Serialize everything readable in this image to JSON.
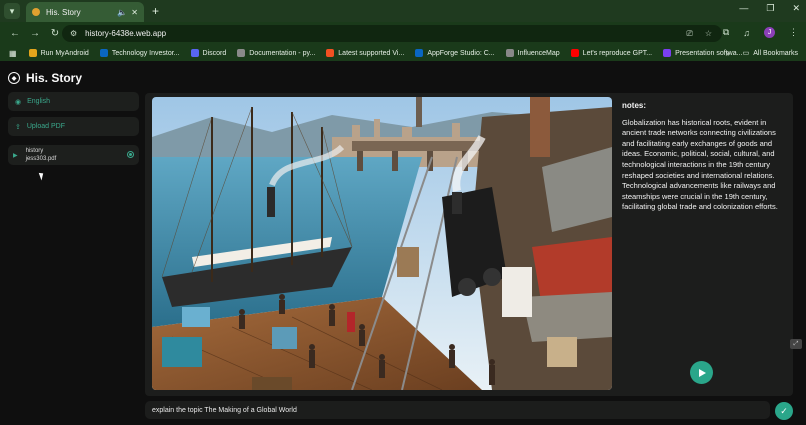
{
  "browser": {
    "tab_title": "His. Story",
    "address": "history-6438e.web.app",
    "bookmarks": [
      {
        "label": "Run MyAndroid",
        "color": "#e3a41c"
      },
      {
        "label": "Technology Investor...",
        "color": "#0a66c2"
      },
      {
        "label": "Discord",
        "color": "#5865f2"
      },
      {
        "label": "Documentation - py...",
        "color": "#8a8a8a"
      },
      {
        "label": "Latest supported Vi...",
        "color": "#f25022"
      },
      {
        "label": "AppForge Studio: C...",
        "color": "#0a66c2"
      },
      {
        "label": "InfluenceMap",
        "color": "#888888"
      },
      {
        "label": "Let's reproduce GPT...",
        "color": "#ff0000"
      },
      {
        "label": "Presentation softwa...",
        "color": "#7a3ff0"
      }
    ],
    "all_bookmarks": "All Bookmarks",
    "profile_initial": "J"
  },
  "app": {
    "title": "His. Story",
    "language_button": "English",
    "upload_button": "Upload PDF",
    "file": {
      "name": "history",
      "filename": "jess303.pdf"
    },
    "notes_heading": "notes:",
    "notes_text": "Globalization has historical roots, evident in ancient trade networks connecting civilizations and facilitating early exchanges of goods and ideas. Economic, political, social, cultural, and technological interactions in the 19th century reshaped societies and international relations. Technological advancements like railways and steamships were crucial in the 19th century, facilitating global trade and colonization efforts.",
    "prompt_value": "explain the topic The Making of a Global World"
  },
  "colors": {
    "accent": "#2aa68a",
    "chrome": "#1a3a1a"
  }
}
